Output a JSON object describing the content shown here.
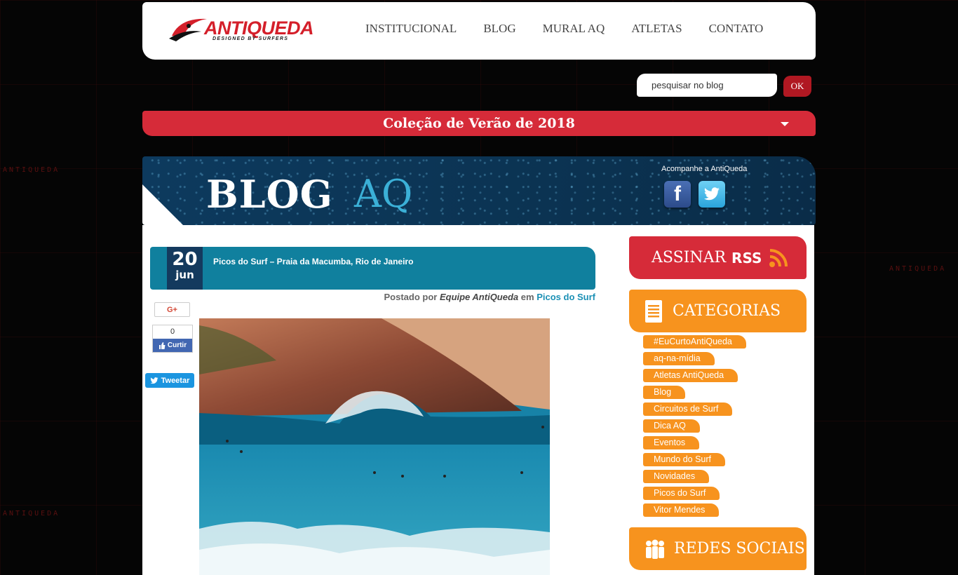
{
  "brand": {
    "logo_text": "ANTIQUEDA",
    "tagline": "DESIGNED BY SURFERS",
    "background_wordmark": "ANTIQUEDA",
    "accent_red": "#d62b39",
    "accent_orange": "#f7931e",
    "accent_teal": "#10809e"
  },
  "nav": {
    "items": [
      {
        "label": "INSTITUCIONAL"
      },
      {
        "label": "BLOG"
      },
      {
        "label": "MURAL AQ"
      },
      {
        "label": "ATLETAS"
      },
      {
        "label": "CONTATO"
      }
    ]
  },
  "search": {
    "placeholder": "pesquisar no blog",
    "button_label": "OK"
  },
  "collection": {
    "title": "Coleção de Verão de 2018"
  },
  "banner": {
    "blog_word": "BLOG",
    "aq_word": "AQ",
    "follow_label": "Acompanhe a AntiQueda",
    "social_icons": [
      "facebook-icon",
      "twitter-icon"
    ]
  },
  "post": {
    "day": "20",
    "month": "jun",
    "title": "Picos do Surf – Praia da Macumba, Rio de Janeiro",
    "posted_prefix": "Postado por",
    "author": "Equipe AntiQueda",
    "in_word": "em",
    "category": "Picos do Surf",
    "share": {
      "gplus_label": "G+",
      "fb_count": "0",
      "fb_label": "Curtir",
      "tweet_label": "Tweetar"
    }
  },
  "sidebar": {
    "rss_label": "ASSINAR",
    "rss_strong": "RSS",
    "categories_title": "CATEGORIAS",
    "categories": [
      "#EuCurtoAntiQueda",
      "aq-na-mídia",
      "Atletas AntiQueda",
      "Blog",
      "Circuitos de Surf",
      "Dica AQ",
      "Eventos",
      "Mundo do Surf",
      "Novidades",
      "Picos do Surf",
      "Vitor Mendes"
    ],
    "social_title": "REDES SOCIAIS"
  }
}
